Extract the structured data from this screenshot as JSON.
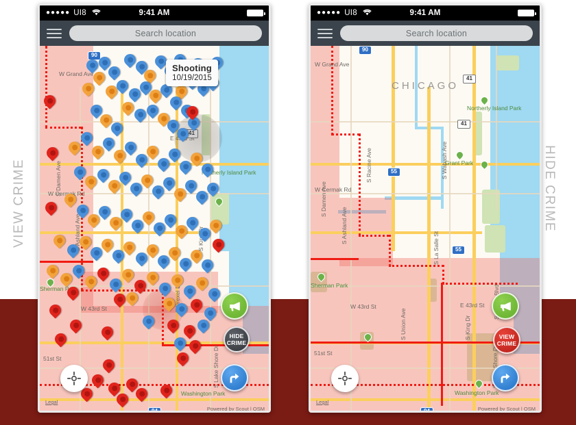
{
  "page": {
    "bg_top_color": "#ffffff",
    "bg_bottom_color": "#7a1b14"
  },
  "side_labels": {
    "left": "VIEW CRIME",
    "right": "HIDE CRIME"
  },
  "status_bar": {
    "signal_dots": "●●●●●",
    "carrier": "UI8",
    "wifi_icon": "wifi-icon",
    "time": "9:41 AM",
    "battery_icon": "battery-full-icon"
  },
  "navbar": {
    "menu_icon": "hamburger-menu-icon",
    "search_placeholder": "Search location"
  },
  "tooltip": {
    "title": "Shooting",
    "date": "10/19/2015"
  },
  "buttons": {
    "left_panel": {
      "report": {
        "icon": "megaphone-icon",
        "color": "#6fba37"
      },
      "toggle": {
        "label_line1": "HIDE",
        "label_line2": "CRIME",
        "color": "#3b3f44"
      },
      "directions": {
        "icon": "turn-right-arrow-icon",
        "color": "#2b7dd4"
      },
      "locate": {
        "icon": "crosshair-locate-icon",
        "color": "#ffffff"
      }
    },
    "right_panel": {
      "report": {
        "icon": "megaphone-icon",
        "color": "#6fba37"
      },
      "toggle": {
        "label_line1": "VIEW",
        "label_line2": "CRIME",
        "color": "#c9241b"
      },
      "directions": {
        "icon": "turn-right-arrow-icon",
        "color": "#2b7dd4"
      },
      "locate": {
        "icon": "crosshair-locate-icon",
        "color": "#ffffff"
      }
    }
  },
  "map": {
    "attribution": "Powered by Scout | OSM",
    "legal": "Legal",
    "city_label": "CHICAGO",
    "labels": [
      "W Grand Ave",
      "W Cermak Rd",
      "W 43rd St",
      "E 43rd St",
      "51st St",
      "S Damen Ave",
      "S Ashland Ave",
      "S Racine Ave",
      "S Wabash Ave",
      "S La Salle St",
      "S Union Ave",
      "S King Dr",
      "S Drexel Blvd",
      "S Lake Shore Dr",
      "Grant Park",
      "Northerly Island Park",
      "Washington Park",
      "Sherman Park"
    ],
    "shields": [
      "90",
      "41",
      "41",
      "55",
      "55",
      "94"
    ]
  },
  "pin_colors": {
    "blue": "#4a90d9",
    "orange": "#f2a33c",
    "red": "#e0241c"
  }
}
